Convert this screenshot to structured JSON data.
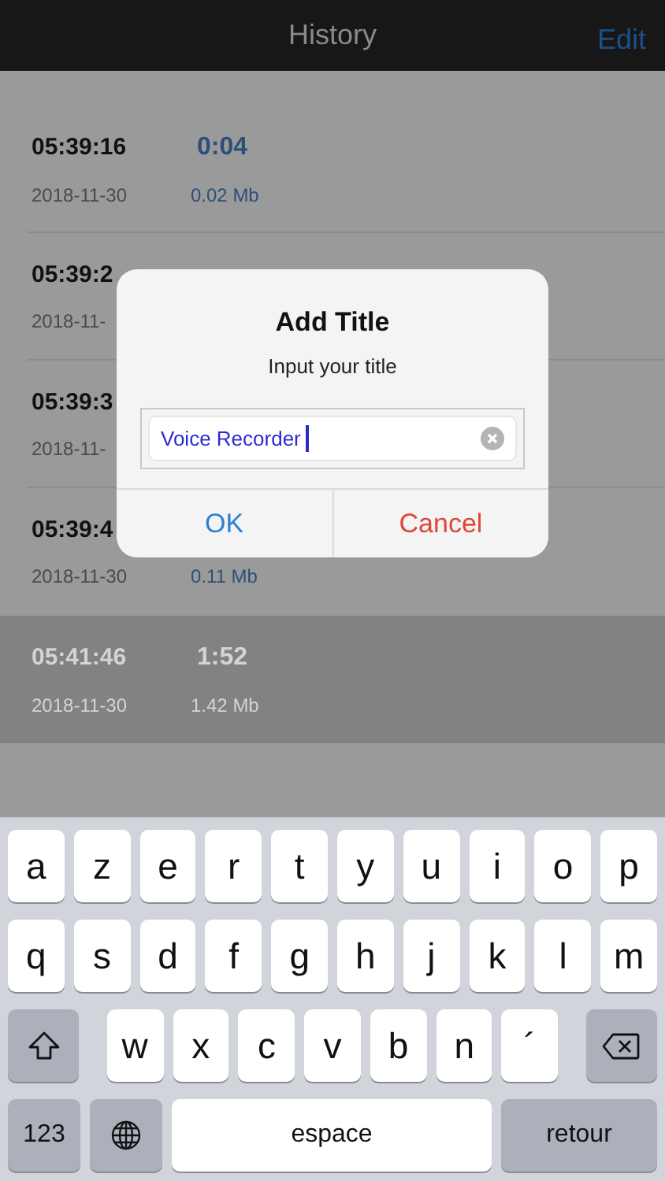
{
  "nav": {
    "title": "History",
    "action": "Edit"
  },
  "recordings": [
    {
      "time": "05:39:16",
      "duration": "0:04",
      "date": "2018-11-30",
      "size": "0.02 Mb",
      "selected": false
    },
    {
      "time": "05:39:2",
      "date": "2018-11-",
      "selected": false
    },
    {
      "time": "05:39:3",
      "date": "2018-11-",
      "selected": false
    },
    {
      "time": "05:39:4",
      "date": "2018-11-30",
      "size": "0.11 Mb",
      "selected": false
    },
    {
      "time": "05:41:46",
      "duration": "1:52",
      "date": "2018-11-30",
      "size": "1.42 Mb",
      "selected": true
    }
  ],
  "dialog": {
    "title": "Add Title",
    "message": "Input your title",
    "field": {
      "value": "Voice Recorder"
    },
    "buttons": [
      {
        "label": "OK",
        "kind": "confirm"
      },
      {
        "label": "Cancel",
        "kind": "cancel"
      }
    ]
  },
  "keyboard": {
    "rows": [
      {
        "keys": [
          {
            "kind": "letter",
            "label": "a"
          },
          {
            "kind": "letter",
            "label": "z"
          },
          {
            "kind": "letter",
            "label": "e"
          },
          {
            "kind": "letter",
            "label": "r"
          },
          {
            "kind": "letter",
            "label": "t"
          },
          {
            "kind": "letter",
            "label": "y"
          },
          {
            "kind": "letter",
            "label": "u"
          },
          {
            "kind": "letter",
            "label": "i"
          },
          {
            "kind": "letter",
            "label": "o"
          },
          {
            "kind": "letter",
            "label": "p"
          }
        ]
      },
      {
        "keys": [
          {
            "kind": "letter",
            "label": "q"
          },
          {
            "kind": "letter",
            "label": "s"
          },
          {
            "kind": "letter",
            "label": "d"
          },
          {
            "kind": "letter",
            "label": "f"
          },
          {
            "kind": "letter",
            "label": "g"
          },
          {
            "kind": "letter",
            "label": "h"
          },
          {
            "kind": "letter",
            "label": "j"
          },
          {
            "kind": "letter",
            "label": "k"
          },
          {
            "kind": "letter",
            "label": "l"
          },
          {
            "kind": "letter",
            "label": "m"
          }
        ]
      },
      {
        "keys": [
          {
            "kind": "shift"
          },
          {
            "kind": "letter",
            "label": "w"
          },
          {
            "kind": "letter",
            "label": "x"
          },
          {
            "kind": "letter",
            "label": "c"
          },
          {
            "kind": "letter",
            "label": "v"
          },
          {
            "kind": "letter",
            "label": "b"
          },
          {
            "kind": "letter",
            "label": "n"
          },
          {
            "kind": "letter",
            "label": "´"
          },
          {
            "kind": "delete"
          }
        ]
      },
      {
        "keys": [
          {
            "kind": "numbers",
            "label": "123"
          },
          {
            "kind": "globe"
          },
          {
            "kind": "space",
            "label": "espace"
          },
          {
            "kind": "return",
            "label": "retour"
          }
        ]
      }
    ]
  }
}
